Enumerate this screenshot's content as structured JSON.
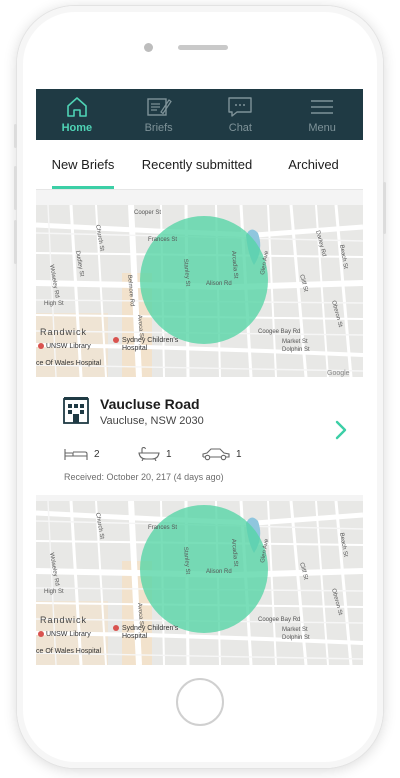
{
  "nav": {
    "items": [
      {
        "label": "Home",
        "icon": "home-icon",
        "active": true
      },
      {
        "label": "Briefs",
        "icon": "briefs-icon",
        "active": false
      },
      {
        "label": "Chat",
        "icon": "chat-icon",
        "active": false
      },
      {
        "label": "Menu",
        "icon": "menu-icon",
        "active": false
      }
    ]
  },
  "tabs": [
    {
      "label": "New Briefs",
      "active": true
    },
    {
      "label": "Recently submitted",
      "active": false
    },
    {
      "label": "Archived",
      "active": false
    }
  ],
  "map_labels": {
    "cooper": "Cooper St",
    "frances": "Frances St",
    "alison": "Alison Rd",
    "coogee": "Coogee Bay Rd",
    "randwick": "Randwick",
    "unsw_library": "UNSW Library",
    "sydney_childrens_1": "Sydney Children's",
    "sydney_childrens_2": "Hospital",
    "wales": "ce Of Wales Hospital",
    "dolphin": "Dolphin St",
    "market": "Market St",
    "cliff": "Cliff St",
    "oberon": "Oberon St",
    "glen": "Glen Ave",
    "church": "Church St",
    "high": "High St",
    "avoca": "Avoca St",
    "belmore": "Belmore Rd",
    "wolseley": "Wolseley Rd",
    "beach": "Beach St",
    "stanley": "Stanley St",
    "arcadia": "Arcadia St",
    "dudley": "Dudley St",
    "darley": "Darley Rd",
    "google": "Google"
  },
  "listing": {
    "title": "Vaucluse Road",
    "subtitle": "Vaucluse, NSW 2030",
    "bedrooms": "2",
    "bathrooms": "1",
    "parking": "1",
    "received": "Received: October 20, 217 (4 days ago)"
  },
  "colors": {
    "nav_bg": "#1f3a44",
    "accent": "#3ccfa6",
    "nav_inactive": "#7f9399",
    "map_circle": "#55d5a5"
  }
}
